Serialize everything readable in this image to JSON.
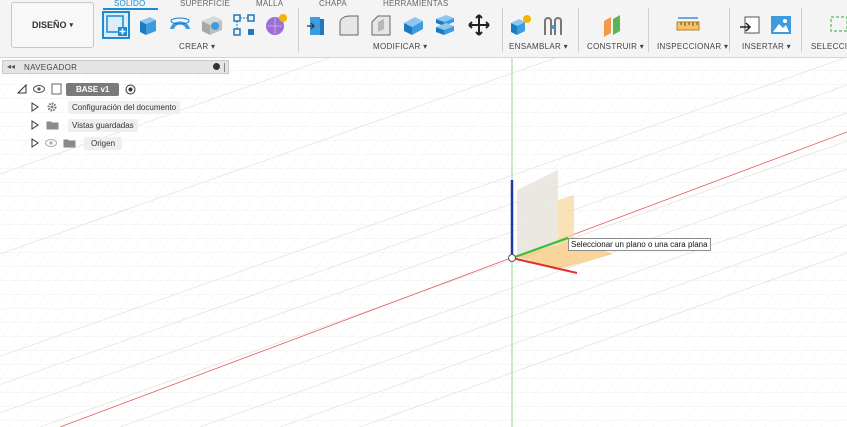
{
  "workspace": {
    "label": "DISEÑO",
    "caret": "▾"
  },
  "tabs": [
    "SÓLIDO",
    "SUPERFICIE",
    "MALLA",
    "CHAPA",
    "HERRAMIENTAS"
  ],
  "groups": {
    "crear": "CREAR ▾",
    "modificar": "MODIFICAR ▾",
    "ensamblar": "ENSAMBLAR ▾",
    "construir": "CONSTRUIR ▾",
    "inspeccionar": "INSPECCIONAR ▾",
    "insertar": "INSERTAR ▾",
    "seleccionar": "SELECCIO"
  },
  "browser": {
    "title": "NAVEGADOR",
    "root": "BASE v1",
    "items": [
      {
        "label": "Configuración del documento",
        "icon": "gear-icon"
      },
      {
        "label": "Vistas guardadas",
        "icon": "folder-icon"
      },
      {
        "label": "Origen",
        "icon": "folder-icon"
      }
    ]
  },
  "tooltip": "Seleccionar un plano o una cara plana",
  "colors": {
    "accent": "#1d8ad2",
    "x_axis": "#e03030",
    "y_axis": "#30c030",
    "z_axis": "#1a3aa8",
    "plane": "#f7c57a"
  }
}
